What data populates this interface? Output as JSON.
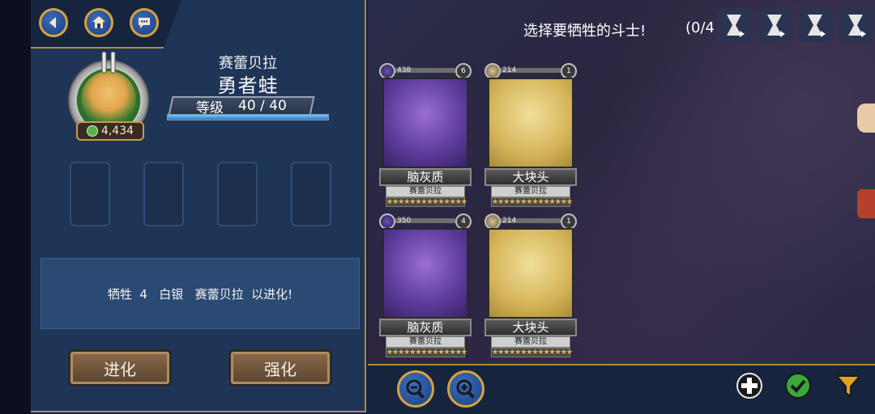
{
  "nav": {
    "back_icon": "back-arrow-icon",
    "home_icon": "home-icon",
    "chat_icon": "chat-bubble-icon"
  },
  "character": {
    "name": "赛蕾贝拉",
    "title": "勇者蛙",
    "level_label": "等级",
    "level_value": "40 / 40",
    "xp_fill_percent": 100,
    "power": "4,434"
  },
  "sacrifice_slots": 4,
  "info_text": "牺牲  4   白银   赛蕾贝拉  以进化!",
  "buttons": {
    "evolve": "进化",
    "enhance": "强化"
  },
  "selection": {
    "title": "选择要牺牲的斗士!",
    "count": "(0/4"
  },
  "cards": [
    {
      "element": "purple",
      "number": "438",
      "badge": "6",
      "name": "脑灰质",
      "owner": "赛蕾贝拉",
      "stars": "★★★★★★★★★★★★★★"
    },
    {
      "element": "gold",
      "number": "214",
      "badge": "1",
      "name": "大块头",
      "owner": "赛蕾贝拉",
      "stars": "★★★★★★★★★★★★★★"
    },
    {
      "element": "purple",
      "number": "350",
      "badge": "4",
      "name": "脑灰质",
      "owner": "赛蕾贝拉",
      "stars": "★★★★★★★★★★★★★★"
    },
    {
      "element": "gold",
      "number": "214",
      "badge": "1",
      "name": "大块头",
      "owner": "赛蕾贝拉",
      "stars": "★★★★★★★★★★★★★★"
    }
  ],
  "colors": {
    "panel": "#1f3558",
    "gold_border": "#b48b3a",
    "accent_green": "#3aa83a"
  }
}
